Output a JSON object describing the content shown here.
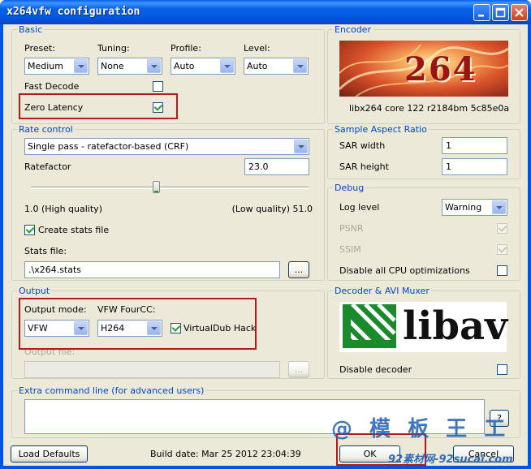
{
  "window": {
    "title": "x264vfw configuration",
    "title_buttons": [
      "minimize-icon",
      "maximize-icon",
      "close-icon"
    ]
  },
  "basic": {
    "legend": "Basic",
    "preset_label": "Preset:",
    "preset_value": "Medium",
    "tuning_label": "Tuning:",
    "tuning_value": "None",
    "profile_label": "Profile:",
    "profile_value": "Auto",
    "level_label": "Level:",
    "level_value": "Auto",
    "fast_decode_label": "Fast Decode",
    "fast_decode_checked": false,
    "zero_latency_label": "Zero Latency",
    "zero_latency_checked": true
  },
  "encoder": {
    "legend": "Encoder",
    "logo_text": "264",
    "version": "libx264 core 122 r2184bm 5c85e0a"
  },
  "rate_control": {
    "legend": "Rate control",
    "mode_value": "Single pass - ratefactor-based (CRF)",
    "ratefactor_label": "Ratefactor",
    "ratefactor_value": "23.0",
    "slider_position": 0.45,
    "min_label": "1.0 (High quality)",
    "max_label": "(Low quality) 51.0",
    "create_stats_label": "Create stats file",
    "create_stats_checked": true,
    "stats_file_label": "Stats file:",
    "stats_file_value": ".\\x264.stats",
    "browse_label": "..."
  },
  "sar": {
    "legend": "Sample Aspect Ratio",
    "width_label": "SAR width",
    "width_value": "1",
    "height_label": "SAR height",
    "height_value": "1"
  },
  "debug": {
    "legend": "Debug",
    "log_level_label": "Log level",
    "log_level_value": "Warning",
    "psnr_label": "PSNR",
    "psnr_checked": true,
    "ssim_label": "SSIM",
    "ssim_checked": true,
    "disable_cpu_label": "Disable all CPU optimizations",
    "disable_cpu_checked": false
  },
  "output": {
    "legend": "Output",
    "mode_label": "Output mode:",
    "mode_value": "VFW",
    "fourcc_label": "VFW FourCC:",
    "fourcc_value": "H264",
    "vdub_label": "VirtualDub Hack",
    "vdub_checked": true,
    "file_label": "Output file:",
    "file_value": "",
    "browse_label": "..."
  },
  "decoder": {
    "legend": "Decoder & AVI Muxer",
    "logo_text": "libav",
    "disable_decoder_label": "Disable decoder",
    "disable_decoder_checked": false
  },
  "extra": {
    "legend": "Extra command line (for advanced users)",
    "value": "",
    "help_label": "?"
  },
  "footer": {
    "load_defaults_label": "Load Defaults",
    "build_date": "Build date: Mar 25 2012 23:04:39",
    "ok_label": "OK",
    "cancel_label": "Cancel"
  },
  "watermark": {
    "text": "@ 模 板 王 工",
    "site": "92素材网-92sucai.com"
  },
  "colors": {
    "title_bar": "#0054e3",
    "dialog_bg": "#ece9d8",
    "group_legend": "#0046d5",
    "highlight_box": "#b31c1c",
    "checkmark": "#21a121",
    "watermark": "#1d5fb5"
  }
}
